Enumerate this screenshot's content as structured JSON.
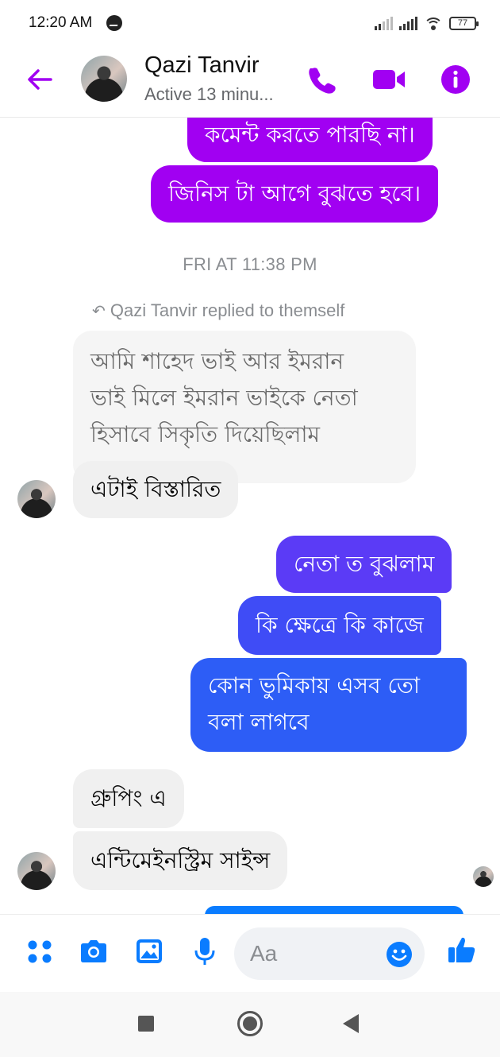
{
  "status_bar": {
    "time": "12:20 AM",
    "battery": "77"
  },
  "header": {
    "contact_name": "Qazi Tanvir",
    "contact_status": "Active 13 minu...",
    "accent_color": "#a100f2"
  },
  "messages": {
    "out_1": "কমেন্ট করতে পারছি না।",
    "out_2": "জিনিস টা আগে বুঝতে হবে।",
    "timestamp": "FRI AT 11:38 PM",
    "reply_note": "Qazi Tanvir replied to themself",
    "quoted_line_1": "আমি শাহেদ ভাই আর ইমরান",
    "quoted_line_2": "ভাই মিলে ইমরান ভাইকে নেতা",
    "quoted_line_3": "হিসাবে সিকৃতি দিয়েছিলাম",
    "in_1": "এটাই বিস্তারিত",
    "out_3": "নেতা ত বুঝলাম",
    "out_4": "কি ক্ষেত্রে কি কাজে",
    "out_5_line_1": "কোন ভুমিকায় এসব তো",
    "out_5_line_2": "বলা লাগবে",
    "in_2": "গ্রুপিং এ",
    "in_3": "এন্টিমেইনস্ট্রিম সাইন্স"
  },
  "composer": {
    "placeholder": "Aa",
    "icon_color": "#0a7cff"
  },
  "colors": {
    "bubble_purple": "#a100f2",
    "bubble_violet": "#5b3bf6",
    "bubble_blue": "#2d5df6",
    "bubble_light_blue": "#0a7cff"
  }
}
